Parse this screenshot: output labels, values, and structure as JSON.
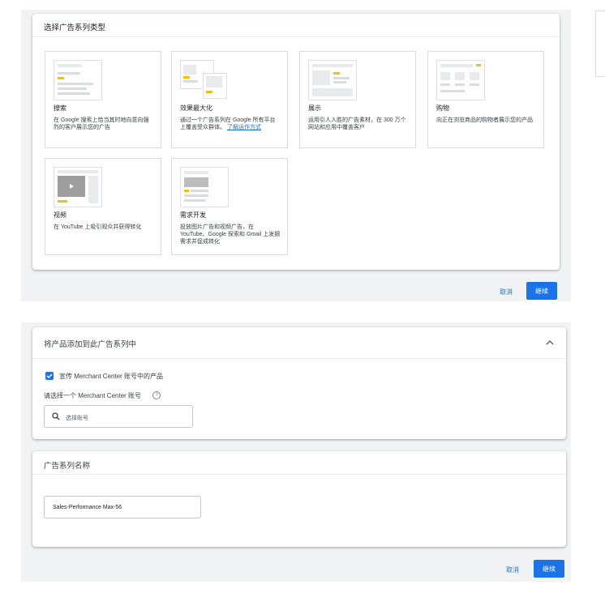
{
  "campaign_type_section": {
    "title": "选择广告系列类型",
    "types": [
      {
        "name": "搜索",
        "desc": "在 Google 搜索上恰当其时地向意向强烈的客户展示您的广告",
        "link": ""
      },
      {
        "name": "效果最大化",
        "desc": "通过一个广告系列在 Google 所有平台上覆盖受众群体。",
        "link": "了解运作方式"
      },
      {
        "name": "展示",
        "desc": "运用引人入胜的广告素材，在 300 万个网站和应用中覆盖客户",
        "link": ""
      },
      {
        "name": "购物",
        "desc": "向正在浏览商品的购物者展示您的产品",
        "link": ""
      },
      {
        "name": "视频",
        "desc": "在 YouTube 上吸引观众并获得转化",
        "link": ""
      },
      {
        "name": "需求开发",
        "desc": "投放图片广告和视频广告，在 YouTube、Google 探索和 Gmail 上发掘需求并促成转化",
        "link": ""
      }
    ],
    "cancel_label": "取消",
    "continue_label": "继续"
  },
  "products_section": {
    "title": "将产品添加到此广告系列中",
    "chevron_icon": "chevron-up-icon",
    "checkbox_label": "宣传 Merchant Center 账号中的产品",
    "checkbox_checked": true,
    "account_label": "请选择一个 Merchant Center 账号",
    "help_icon": "help-icon",
    "search_placeholder": "选择账号"
  },
  "campaign_name_section": {
    "title": "广告系列名称",
    "value": "Sales-Performance Max-56"
  },
  "footer": {
    "cancel_label": "取消",
    "continue_label": "继续"
  },
  "colors": {
    "accent": "#1a73e8",
    "yellow": "#fbbc04",
    "background": "#f1f3f4"
  }
}
